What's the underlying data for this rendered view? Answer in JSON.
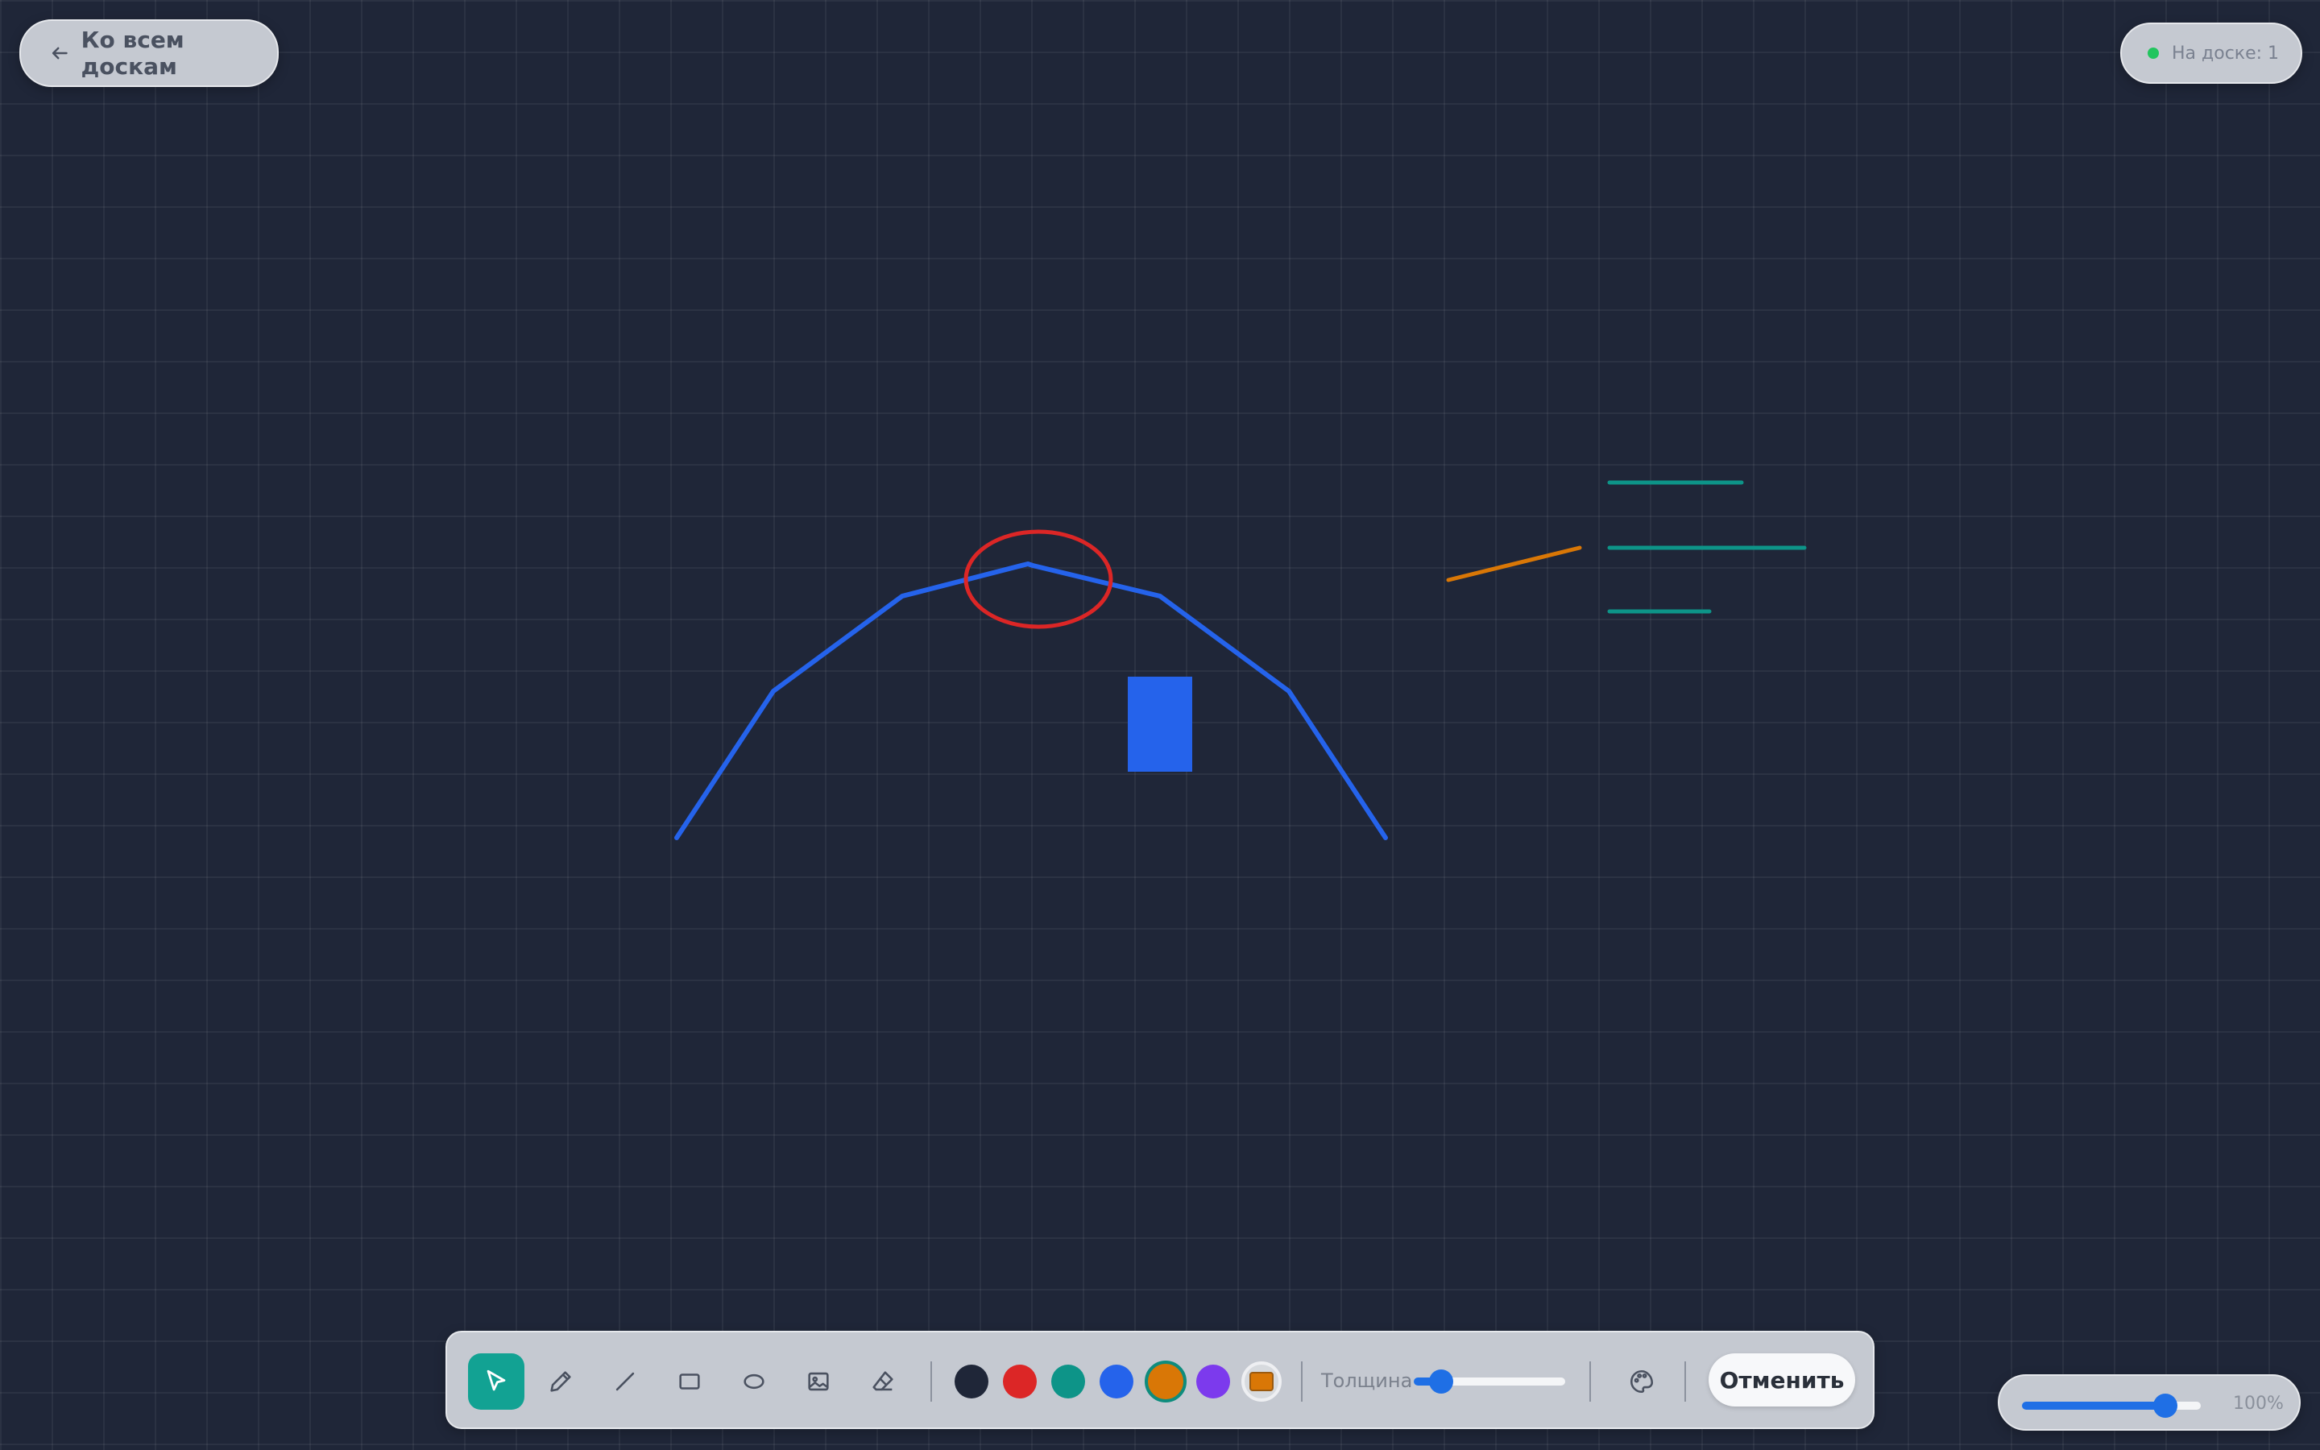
{
  "header": {
    "back_label": "Ко всем доскам",
    "back_icon": "arrow-left-icon",
    "presence_label": "На доске: 1",
    "presence_color": "#22c55e"
  },
  "toolbar": {
    "tools": [
      {
        "name": "select",
        "icon": "cursor-icon",
        "active": true
      },
      {
        "name": "pencil",
        "icon": "pencil-icon",
        "active": false
      },
      {
        "name": "line",
        "icon": "line-icon",
        "active": false
      },
      {
        "name": "rectangle",
        "icon": "rectangle-icon",
        "active": false
      },
      {
        "name": "ellipse",
        "icon": "ellipse-icon",
        "active": false
      },
      {
        "name": "image",
        "icon": "image-icon",
        "active": false
      },
      {
        "name": "eraser",
        "icon": "eraser-icon",
        "active": false
      }
    ],
    "colors": [
      "#1f2638",
      "#dc2626",
      "#0d9488",
      "#2563eb",
      "#d97706",
      "#7c3aed"
    ],
    "selected_color": "#d97706",
    "custom_color": "#d97706",
    "thickness_label": "Толщина",
    "thickness_level": 0.18,
    "palette_icon": "palette-icon",
    "undo_label": "Отменить"
  },
  "zoom": {
    "level": 0.8,
    "label": "100%"
  },
  "board": {
    "active_color": "#12a293",
    "line_colors": {
      "blue": "#2563eb",
      "red": "#dc2626",
      "orange": "#d97706",
      "teal": "#0d9488"
    }
  }
}
